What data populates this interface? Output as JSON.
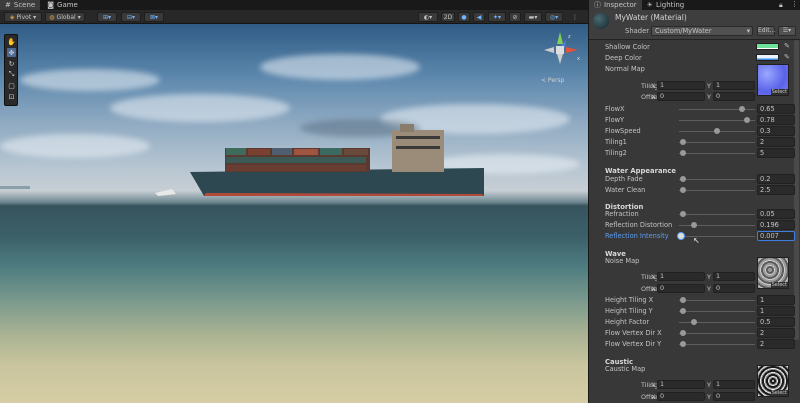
{
  "scene_window": {
    "tabs": [
      {
        "label": "Scene",
        "icon": "hashtag-icon"
      },
      {
        "label": "Game",
        "icon": "gamepad-icon"
      }
    ],
    "toolbar": {
      "pivot_label": "Pivot",
      "global_label": "Global",
      "mode_2d": "2D"
    },
    "gizmo": {
      "persp_label": "< Persp",
      "axis_x": "x",
      "axis_y": "y",
      "axis_z": "z"
    }
  },
  "inspector": {
    "tabs": [
      {
        "label": "Inspector",
        "icon": "info-icon"
      },
      {
        "label": "Lighting",
        "icon": "bulb-icon"
      }
    ],
    "material": {
      "name": "MyWater (Material)",
      "shader_label": "Shader",
      "shader_value": "Custom/MyWater",
      "edit_label": "Edit..."
    },
    "colors": {
      "shallow": {
        "label": "Shallow Color",
        "value": "#6ee29a"
      },
      "deep": {
        "label": "Deep Color",
        "value": "#eaf4ff"
      },
      "accent": "#3d7ee0"
    },
    "normal_map": {
      "label": "Normal Map",
      "tiling_label": "Tiling",
      "offset_label": "Offset",
      "tiling": {
        "x": "1",
        "y": "1"
      },
      "offset": {
        "x": "0",
        "y": "0"
      },
      "select_label": "Select"
    },
    "flow_props": [
      {
        "label": "FlowX",
        "value": "0.65",
        "fraction": 0.83
      },
      {
        "label": "FlowY",
        "value": "0.78",
        "fraction": 0.89
      },
      {
        "label": "FlowSpeed",
        "value": "0.3",
        "fraction": 0.5
      },
      {
        "label": "Tiling1",
        "value": "2",
        "fraction": 0.05
      },
      {
        "label": "Tiling2",
        "value": "5",
        "fraction": 0.05
      }
    ],
    "water_appearance": {
      "title": "Water Appearance",
      "props": [
        {
          "label": "Depth Fade",
          "value": "0.2",
          "fraction": 0.05
        },
        {
          "label": "Water Clean",
          "value": "2.5",
          "fraction": 0.05
        }
      ]
    },
    "distortion": {
      "title": "Distortion",
      "props": [
        {
          "label": "Refraction",
          "value": "0.05",
          "fraction": 0.05
        },
        {
          "label": "Reflection Distortion",
          "value": "0.196",
          "fraction": 0.2
        },
        {
          "label": "Reflection Intensity",
          "value": "0.007",
          "fraction": 0.03
        }
      ]
    },
    "wave": {
      "title": "Wave",
      "noise_label": "Noise Map",
      "tiling_label": "Tiling",
      "offset_label": "Offset",
      "tiling": {
        "x": "1",
        "y": "1"
      },
      "offset": {
        "x": "0",
        "y": "0"
      },
      "select_label": "Select",
      "props": [
        {
          "label": "Height Tiling X",
          "value": "1",
          "fraction": 0.05
        },
        {
          "label": "Height Tiling Y",
          "value": "1",
          "fraction": 0.05
        },
        {
          "label": "Height Factor",
          "value": "0.5",
          "fraction": 0.2
        },
        {
          "label": "Flow Vertex Dir X",
          "value": "2",
          "fraction": 0.05
        },
        {
          "label": "Flow Vertex Dir Y",
          "value": "2",
          "fraction": 0.05
        }
      ]
    },
    "caustic": {
      "title": "Caustic",
      "map_label": "Caustic Map",
      "tiling_label": "Tiling",
      "offset_label": "Offset",
      "tiling": {
        "x": "1",
        "y": "1"
      },
      "offset": {
        "x": "0",
        "y": "0"
      },
      "select_label": "Select"
    },
    "xy": {
      "x": "X",
      "y": "Y"
    }
  }
}
